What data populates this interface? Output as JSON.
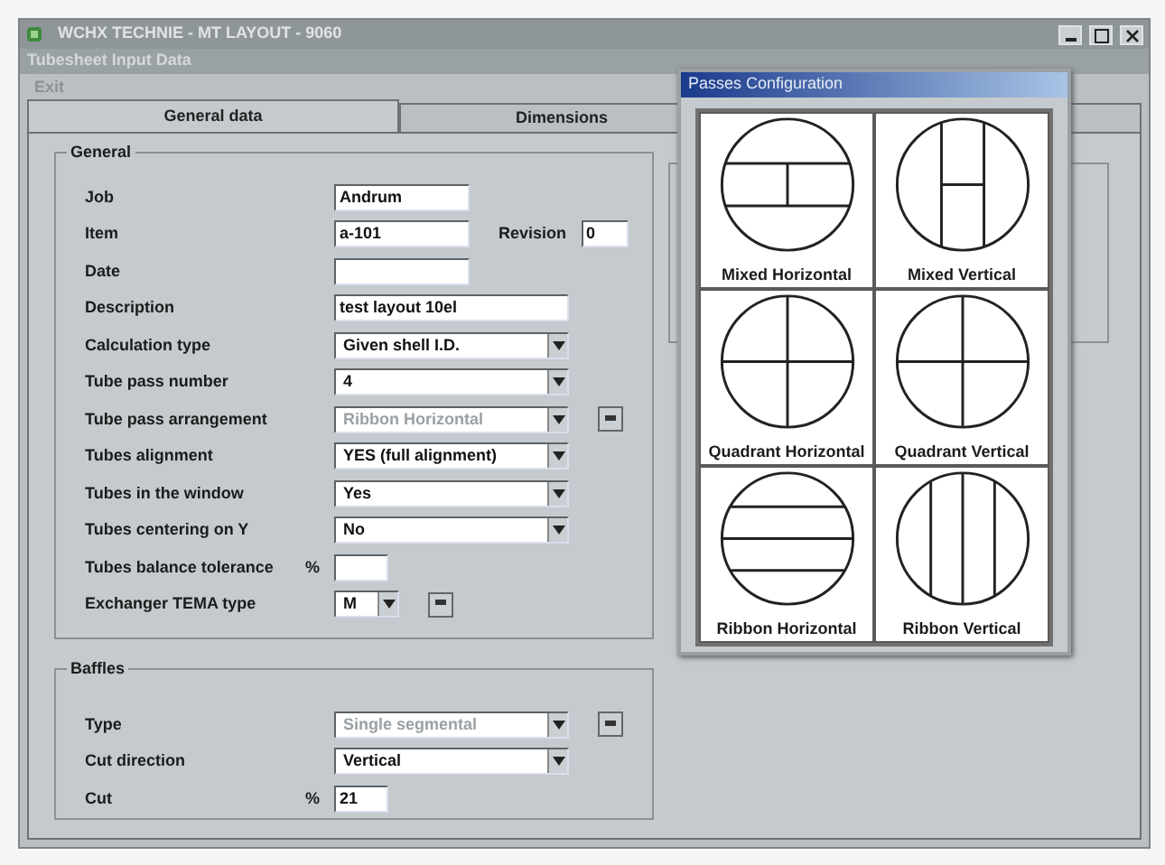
{
  "window": {
    "title": "WCHX TECHNIE - MT LAYOUT - 9060"
  },
  "inner_window": {
    "title": "Tubesheet Input Data"
  },
  "menu": [
    "Exit"
  ],
  "tabs": [
    {
      "label": "General data",
      "selected": true
    },
    {
      "label": "Dimensions",
      "selected": false
    }
  ],
  "general": {
    "title": "General",
    "fields": [
      {
        "label": "Job",
        "kind": "text",
        "value": "Andrum"
      },
      {
        "label": "Item",
        "kind": "text",
        "value": "a-101",
        "extra": {
          "label": "Revision",
          "value": "0"
        }
      },
      {
        "label": "Date",
        "kind": "text"
      },
      {
        "label": "Description",
        "kind": "long_text",
        "value": "test layout 10el"
      },
      {
        "label": "Calculation type",
        "kind": "select",
        "value": "Given shell I.D."
      },
      {
        "label": "Tube pass number",
        "kind": "select",
        "value": "4"
      },
      {
        "label": "Tube pass arrangement",
        "kind": "select",
        "value": "Ribbon Horizontal",
        "disabled": true,
        "more_button": true
      },
      {
        "label": "Tubes alignment",
        "kind": "select",
        "value": "YES (full alignment)"
      },
      {
        "label": "Tubes in the window",
        "kind": "select",
        "value": "Yes"
      },
      {
        "label": "Tubes centering on Y",
        "kind": "select",
        "value": "No"
      },
      {
        "label": "Tubes balance tolerance",
        "kind": "small_text",
        "unit": "%"
      },
      {
        "label": "Exchanger TEMA type",
        "kind": "spin",
        "value": "M",
        "more_button": true
      }
    ]
  },
  "baffles": {
    "title": "Baffles",
    "fields": [
      {
        "label": "Type",
        "kind": "select",
        "value": "Single segmental",
        "disabled": true,
        "more_button": true
      },
      {
        "label": "Cut direction",
        "kind": "select",
        "value": "Vertical"
      },
      {
        "label": "Cut",
        "kind": "small_text",
        "unit": "%",
        "value": "21"
      }
    ]
  },
  "dialog": {
    "title": "Passes Configuration",
    "options": [
      {
        "label": "Mixed Horizontal",
        "kind": "mixed_horizontal"
      },
      {
        "label": "Mixed Vertical",
        "kind": "mixed_vertical"
      },
      {
        "label": "Quadrant Horizontal",
        "kind": "quadrant"
      },
      {
        "label": "Quadrant Vertical",
        "kind": "quadrant"
      },
      {
        "label": "Ribbon Horizontal",
        "kind": "ribbon_horizontal"
      },
      {
        "label": "Ribbon Vertical",
        "kind": "ribbon_vertical"
      }
    ]
  }
}
